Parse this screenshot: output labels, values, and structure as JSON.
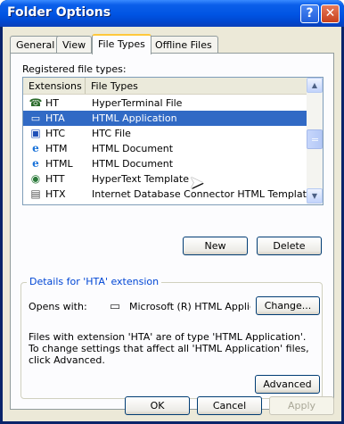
{
  "window": {
    "title": "Folder Options",
    "help_label": "?",
    "close_label": "✕"
  },
  "tabs": [
    {
      "label": "General"
    },
    {
      "label": "View"
    },
    {
      "label": "File Types",
      "active": true
    },
    {
      "label": "Offline Files"
    }
  ],
  "file_types": {
    "registered_label": "Registered file types:",
    "columns": [
      "Extensions",
      "File Types"
    ],
    "rows": [
      {
        "ext": "HT",
        "type": "HyperTerminal File",
        "icon": "hyperterminal-icon"
      },
      {
        "ext": "HTA",
        "type": "HTML Application",
        "icon": "application-icon",
        "selected": true
      },
      {
        "ext": "HTC",
        "type": "HTC File",
        "icon": "htc-icon"
      },
      {
        "ext": "HTM",
        "type": "HTML Document",
        "icon": "internet-explorer-icon"
      },
      {
        "ext": "HTML",
        "type": "HTML Document",
        "icon": "internet-explorer-icon"
      },
      {
        "ext": "HTT",
        "type": "HyperText Template",
        "icon": "htt-icon"
      },
      {
        "ext": "HTX",
        "type": "Internet Database Connector HTML Template",
        "icon": "idc-icon"
      }
    ],
    "new_label": "New",
    "delete_label": "Delete"
  },
  "details": {
    "legend": "Details for 'HTA' extension",
    "opens_with_label": "Opens with:",
    "opens_with_value": "Microsoft (R) HTML Applica",
    "change_label": "Change...",
    "description": "Files with extension 'HTA' are of type 'HTML Application'.  To change settings that affect all 'HTML Application' files, click Advanced.",
    "advanced_label": "Advanced"
  },
  "footer": {
    "ok_label": "OK",
    "cancel_label": "Cancel",
    "apply_label": "Apply"
  },
  "colors": {
    "titlebar": "#0054e3",
    "selection": "#316ac5",
    "legend_text": "#0046d5"
  }
}
